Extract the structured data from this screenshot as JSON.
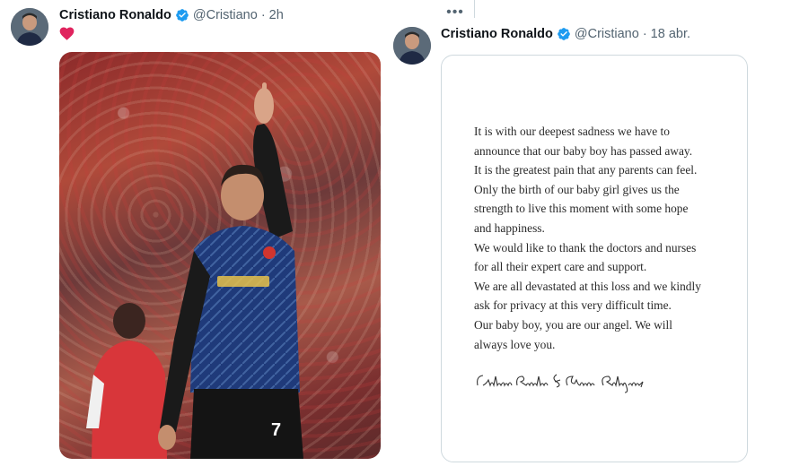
{
  "left_tweet": {
    "author_name": "Cristiano Ronaldo",
    "handle": "@Cristiano",
    "separator": "·",
    "time": "2h",
    "content_icon": "red-heart-emoji",
    "more_icon": "more-horizontal-icon",
    "media": "photo"
  },
  "right_tweet": {
    "author_name": "Cristiano Ronaldo",
    "handle": "@Cristiano",
    "separator": "·",
    "time": "18 abr.",
    "statement": "It is with our deepest sadness we have to\nannounce that our baby boy has passed away.\nIt is the greatest pain that any parents can feel.\nOnly the birth of our baby girl gives us the\nstrength to live this moment with some hope\nand happiness.\nWe would like to thank the doctors and nurses\nfor all their expert care and support.\nWe are all devastated at this loss and we kindly\nask for privacy at this very difficult time.\nOur baby boy, you are our angel. We will\nalways love you.",
    "signature": "Cristiano Ronaldo & Georgina Rodríguez"
  },
  "colors": {
    "text_primary": "#0f1419",
    "text_secondary": "#536471",
    "verified_blue": "#1d9bf0",
    "heart_red": "#e0245e",
    "border": "#cfd9de"
  }
}
